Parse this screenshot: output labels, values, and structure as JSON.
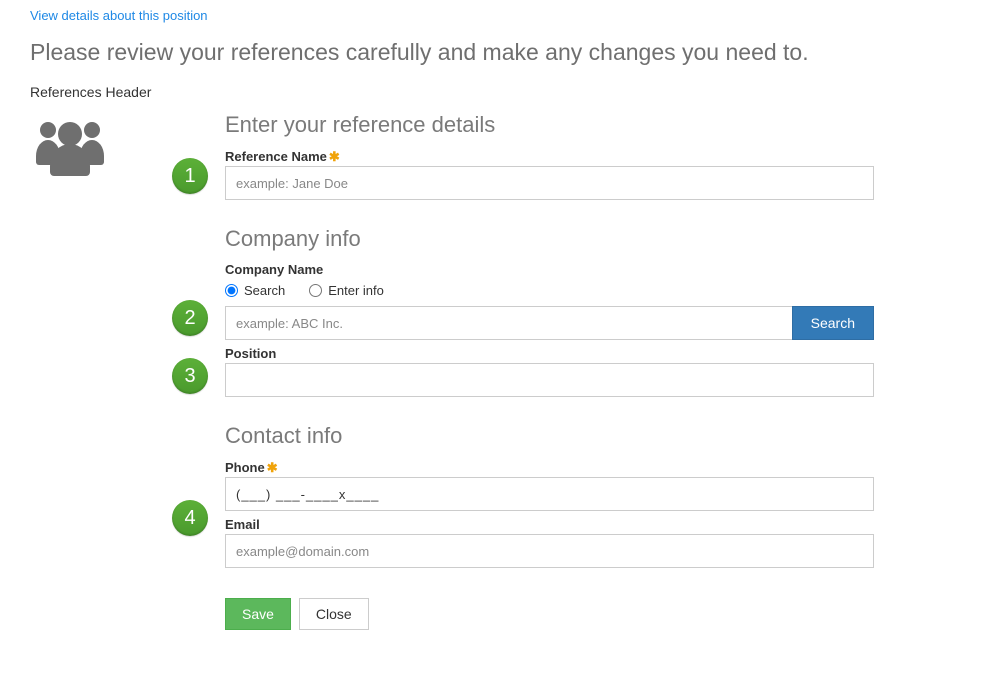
{
  "header": {
    "details_link": "View details about this position",
    "instruction": "Please review your references carefully and make any changes you need to.",
    "refs_header": "References Header"
  },
  "steps": [
    "1",
    "2",
    "3",
    "4"
  ],
  "section1": {
    "title": "Enter your reference details",
    "ref_name_label": "Reference Name",
    "ref_name_placeholder": "example: Jane Doe"
  },
  "section2": {
    "title": "Company info",
    "company_label": "Company Name",
    "radio_search": "Search",
    "radio_enter": "Enter info",
    "company_placeholder": "example: ABC Inc.",
    "search_button": "Search",
    "position_label": "Position"
  },
  "section3": {
    "title": "Contact info",
    "phone_label": "Phone",
    "phone_value": "(___) ___-____x____",
    "email_label": "Email",
    "email_placeholder": "example@domain.com"
  },
  "buttons": {
    "save": "Save",
    "close": "Close"
  }
}
